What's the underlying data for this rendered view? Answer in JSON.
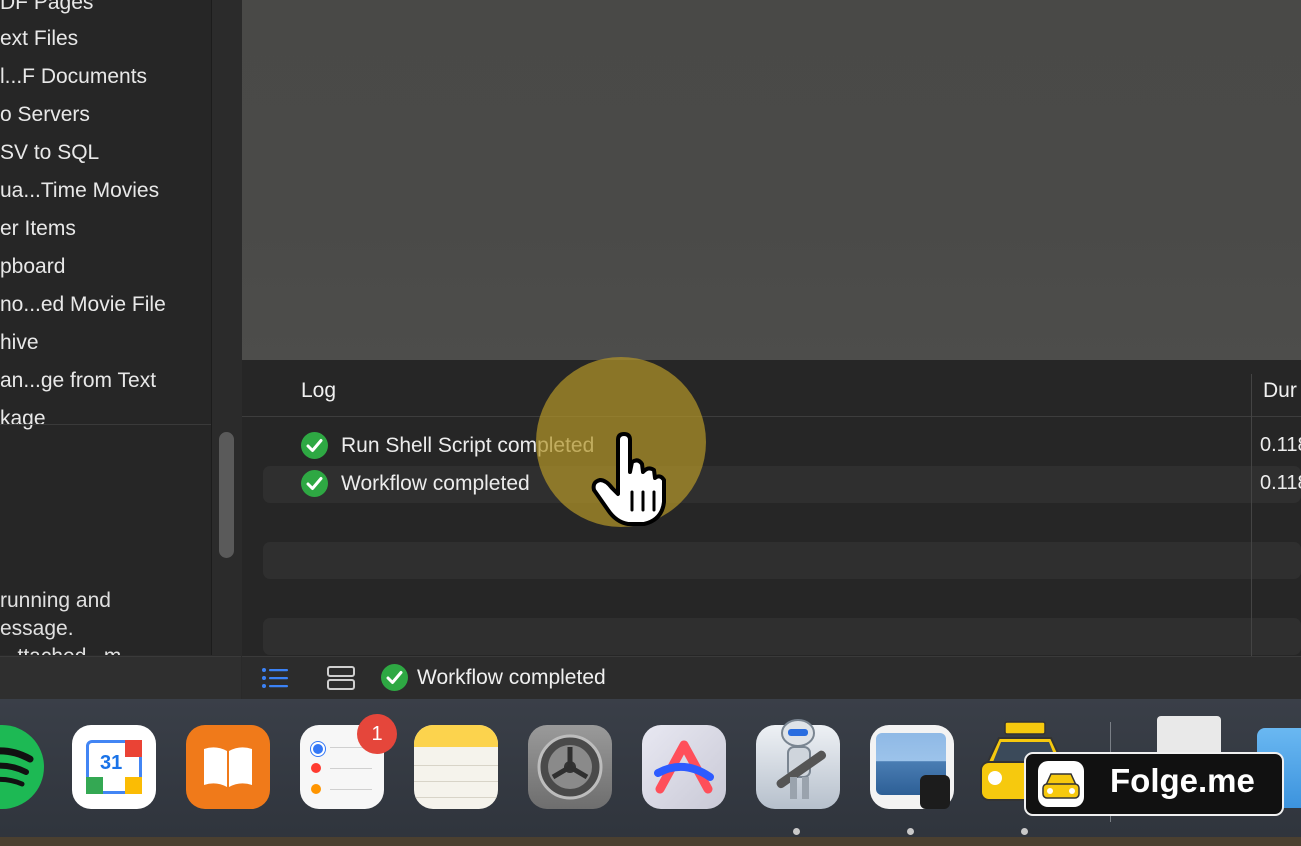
{
  "sidebar": {
    "items": [
      "DF Pages",
      "ext Files",
      "l...F Documents",
      "o Servers",
      "SV to SQL",
      "ua...Time Movies",
      "er Items",
      "pboard",
      "no...ed Movie File",
      "hive",
      "an...ge from Text",
      "kage"
    ],
    "description": [
      "running and",
      "essage.",
      "...ttached...m"
    ]
  },
  "log": {
    "header_log": "Log",
    "header_duration": "Dur",
    "rows": [
      {
        "text": "Run Shell Script completed",
        "duration": "0.118",
        "icon": "checkmark-icon"
      },
      {
        "text": "Workflow completed",
        "duration": "0.118",
        "icon": "checkmark-icon"
      }
    ]
  },
  "statusbar": {
    "status_text": "Workflow completed",
    "list_view_icon": "list-view-icon",
    "split_view_icon": "split-view-icon"
  },
  "dock": {
    "apps": [
      {
        "name": "spotify-icon"
      },
      {
        "name": "google-calendar-icon",
        "label": "31"
      },
      {
        "name": "books-icon"
      },
      {
        "name": "reminders-icon",
        "badge": "1"
      },
      {
        "name": "notes-icon"
      },
      {
        "name": "system-settings-icon"
      },
      {
        "name": "arc-browser-icon"
      },
      {
        "name": "automator-icon"
      },
      {
        "name": "preview-icon"
      },
      {
        "name": "follow-me-taxi-icon"
      },
      {
        "name": "document-icon"
      },
      {
        "name": "folder-icon"
      }
    ]
  },
  "watermark": {
    "text": "Folge.me"
  },
  "colors": {
    "accent_green": "#2ea843",
    "badge_red": "#e5463b",
    "cursor_halo": "#b29428"
  }
}
